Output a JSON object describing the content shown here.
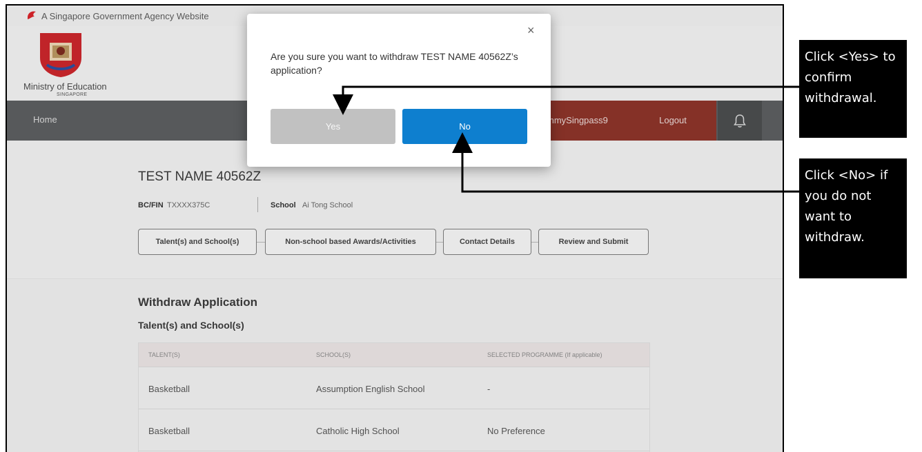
{
  "gov_banner": {
    "text": "A Singapore Government Agency Website"
  },
  "header": {
    "org_name": "Ministry of Education",
    "org_subtitle": "SINGAPORE"
  },
  "nav": {
    "home": "Home",
    "user": "mmySingpass9",
    "logout": "Logout",
    "bell_icon": "bell-icon"
  },
  "profile": {
    "name": "TEST NAME 40562Z",
    "bcfin_label": "BC/FIN",
    "bcfin_value": "TXXXX375C",
    "school_label": "School",
    "school_value": "Ai Tong School",
    "tabs": [
      {
        "label": "Talent(s) and School(s)"
      },
      {
        "label": "Non-school based Awards/Activities"
      },
      {
        "label": "Contact Details"
      },
      {
        "label": "Review and Submit"
      }
    ]
  },
  "main": {
    "title": "Withdraw Application",
    "section_title": "Talent(s) and School(s)",
    "table": {
      "headers": [
        "TALENT(S)",
        "SCHOOL(S)",
        "SELECTED PROGRAMME (If applicable)"
      ],
      "rows": [
        [
          "Basketball",
          "Assumption English School",
          "-"
        ],
        [
          "Basketball",
          "Catholic High School",
          "No Preference"
        ]
      ]
    }
  },
  "modal": {
    "question": "Are you sure you want to withdraw TEST NAME 40562Z’s application?",
    "close_symbol": "×",
    "yes_label": "Yes",
    "no_label": "No"
  },
  "annotations": {
    "yes": "Click <Yes> to confirm withdrawal.",
    "no": "Click <No> if you do not want to withdraw."
  },
  "colors": {
    "nav": "#5b5d5f",
    "user_logout": "#8b3329",
    "no_button": "#0e7fcf",
    "yes_button": "#c1c1c1",
    "callout": "#000000"
  }
}
